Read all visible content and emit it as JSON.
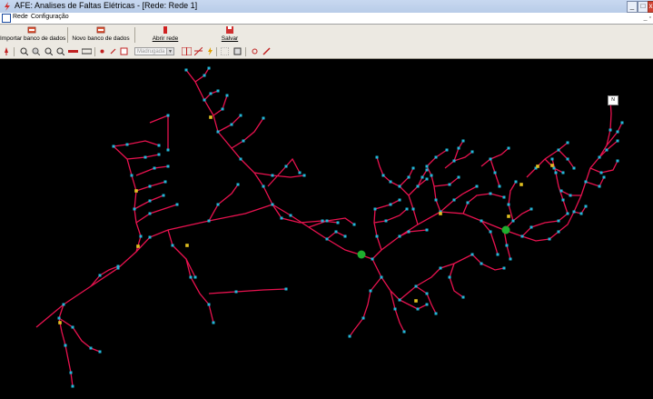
{
  "window": {
    "title": "AFE: Analises de Faltas Elétricas - [Rede: Rede 1]"
  },
  "menu": {
    "items": [
      "Rede",
      "Configuração"
    ]
  },
  "toolbar": {
    "import_label": "Importar banco de dados",
    "new_db_label": "Novo banco de dados",
    "open_label": "Abrir rede",
    "save_label": "Salvar"
  },
  "toolbar2": {
    "period_value": "Madrugada"
  },
  "canvas": {
    "legend_label": "N",
    "colors": {
      "background": "#000000",
      "line": "#e8124f",
      "node": "#22b7d8",
      "device": "#e0c020",
      "substation": "#1fae2e"
    }
  }
}
